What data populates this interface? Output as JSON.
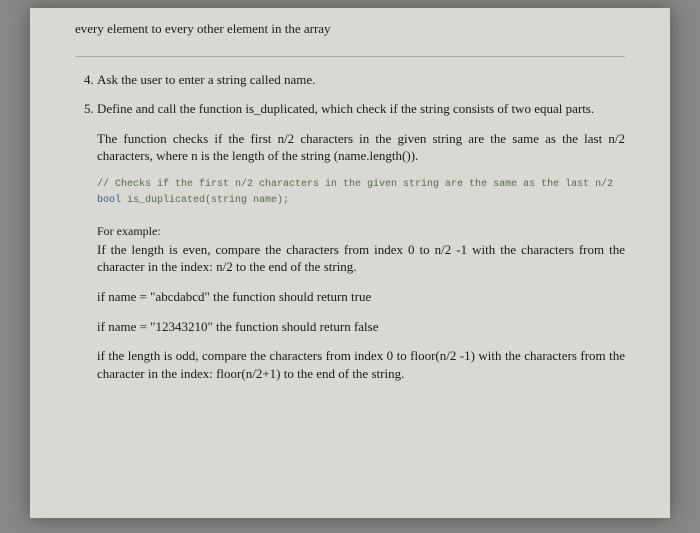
{
  "topLine": "every element to every other element in the array",
  "item4": "Ask the user to enter a string called name.",
  "item5": "Define and call the function is_duplicated, which check if the string consists of two equal parts.",
  "para1": "The function checks if the first n/2 characters in the given string are the same as the last n/2 characters, where n is the length of the string (name.length()).",
  "codeComment": "// Checks if the first n/2 characters in the given string are the same as the last n/2",
  "codeKw": "bool",
  "codeRest": " is_duplicated(string name);",
  "forExample": "For example:",
  "para2": "If the length is even, compare the characters from index 0 to n/2 -1 with the characters from the character in the index: n/2 to the end of the string.",
  "ex1": "if name = \"abcdabcd\" the function should return true",
  "ex2": "if name = \"12343210\" the function should return false",
  "para3": "if the length is odd, compare the characters from index 0 to floor(n/2 -1) with the characters from the character in the index: floor(n/2+1) to the end of the string."
}
